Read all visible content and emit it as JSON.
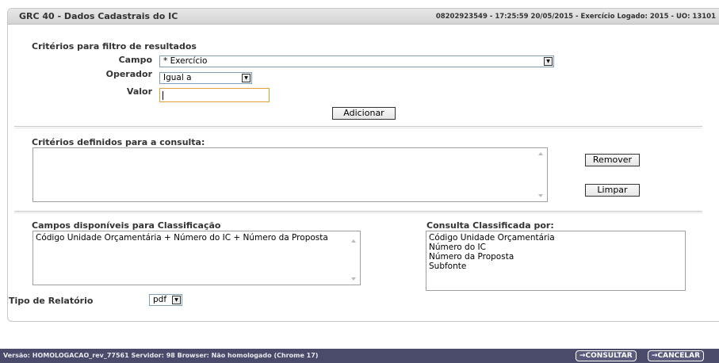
{
  "header": {
    "title": "GRC 40 - Dados Cadastrais do IC",
    "info": "08202923549 - 17:25:59 20/05/2015 - Exercício Logado: 2015 - UO: 13101"
  },
  "filter": {
    "section_title": "Critérios para filtro de resultados",
    "campo_label": "Campo",
    "campo_value": "* Exercício",
    "operador_label": "Operador",
    "operador_value": "Igual a",
    "valor_label": "Valor",
    "valor_value": "",
    "add_button": "Adicionar"
  },
  "criteria": {
    "section_title": "Critérios definidos para a consulta:",
    "remove_button": "Remover",
    "clear_button": "Limpar"
  },
  "sorting": {
    "available_title": "Campos disponíveis para Classificação",
    "available_items": [
      "Código Unidade Orçamentária + Número do IC + Número da Proposta"
    ],
    "sorted_title": "Consulta Classificada por:",
    "sorted_items": [
      "Código Unidade Orçamentária",
      "Número do IC",
      "Número da Proposta",
      "Subfonte"
    ]
  },
  "report": {
    "label": "Tipo de Relatório",
    "value": "pdf"
  },
  "footer": {
    "version_text": "Versão: HOMOLOGACAO_rev_77561  Servidor: 98  Browser: Não homologado (Chrome 17)",
    "consultar_button": "→CONSULTAR",
    "cancelar_button": "→CANCELAR"
  },
  "colors": {
    "footer_bg": "#4a4a6a",
    "input_focus_border": "#e3a03a",
    "title_bar_bg": "#d4d4d4"
  },
  "icons": {
    "dropdown": "chevron-down-icon",
    "scroll_up": "scroll-up-icon",
    "scroll_down": "scroll-down-icon"
  }
}
